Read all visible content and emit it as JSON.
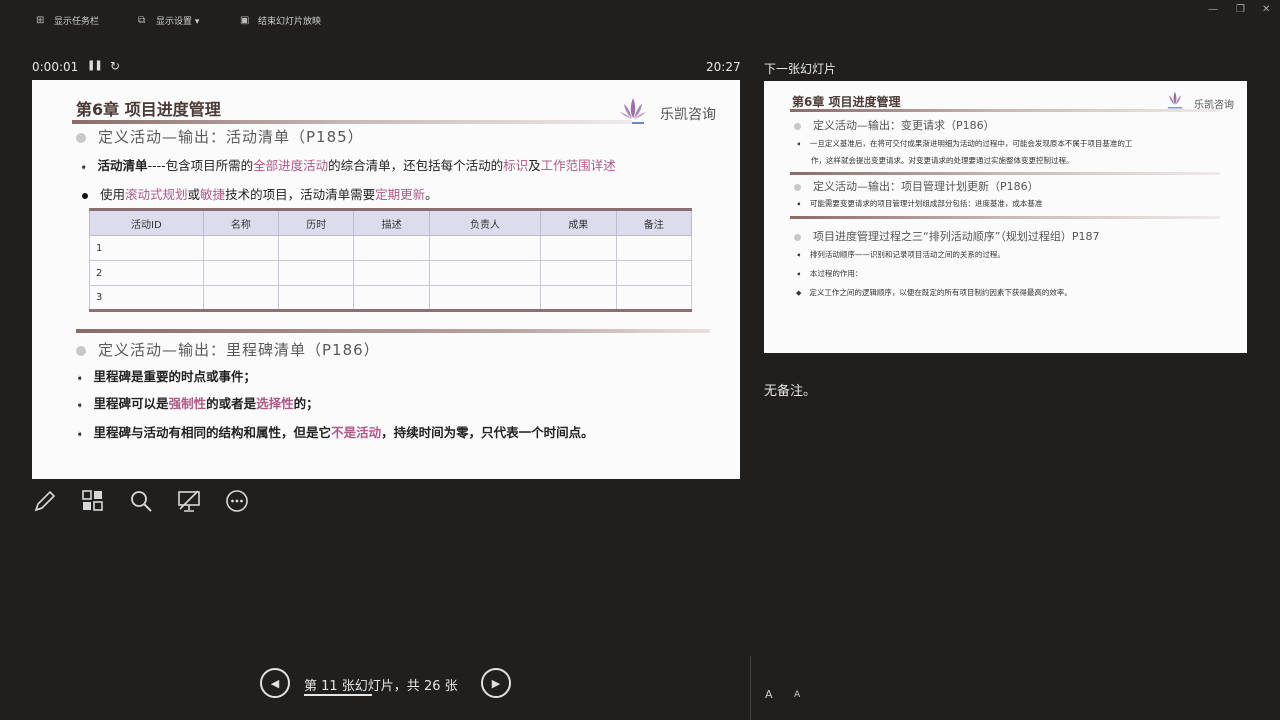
{
  "toolbar": {
    "show_taskbar": "显示任务栏",
    "display_settings": "显示设置 ▾",
    "end_slideshow": "结束幻灯片放映"
  },
  "presenter": {
    "elapsed": "0:00:01",
    "clock": "20:27",
    "next_label": "下一张幻灯片",
    "notes": "无备注。",
    "slide_counter": "第 11 张幻灯片，共 26 张",
    "font_increase": "A",
    "font_decrease": "A"
  },
  "slide": {
    "title": "第6章 项目进度管理",
    "logo_text": "乐凯咨询",
    "section1": "定义活动—输出：活动清单（P185）",
    "b1_bold": "活动清单",
    "b1_a": "----包含项目所需的",
    "b1_hl1": "全部进度活动",
    "b1_b": "的综合清单，还包括每个活动的",
    "b1_hl2": "标识",
    "b1_c": "及",
    "b1_hl3": "工作范围详述",
    "b2_a": "使用",
    "b2_hl1": "滚动式规划",
    "b2_b": "或",
    "b2_hl2": "敏捷",
    "b2_c": "技术的项目，活动清单需要",
    "b2_hl3": "定期更新",
    "b2_d": "。",
    "table": {
      "headers": [
        "活动ID",
        "名称",
        "历时",
        "描述",
        "负责人",
        "成果",
        "备注"
      ],
      "rows": [
        "1",
        "2",
        "3"
      ]
    },
    "section2": "定义活动—输出：里程碑清单（P186）",
    "m1": "里程碑是重要的时点或事件；",
    "m2_a": "里程碑可以是",
    "m2_hl1": "强制性",
    "m2_b": "的或者是",
    "m2_hl2": "选择性",
    "m2_c": "的；",
    "m3_a": "里程碑与活动有相同的结构和属性，但是它",
    "m3_hl": "不是活动",
    "m3_b": "，持续时间为零，只代表一个时间点。"
  },
  "next_slide": {
    "title": "第6章 项目进度管理",
    "logo_text": "乐凯咨询",
    "s1": "定义活动—输出：变更请求（P186）",
    "s1_b1": "一旦定义基准后，在将可交付成果渐进明细为活动的过程中，可能会发现原本不属于项目基准的工",
    "s1_b2": "作，这样就会提出变更请求。对变更请求的处理要通过实施整体变更控制过程。",
    "s2": "定义活动—输出：项目管理计划更新（P186）",
    "s2_b1": "可能需要变更请求的项目管理计划组成部分包括：进度基准，成本基准",
    "s3": "项目进度管理过程之三“排列活动顺序”（规划过程组）P187",
    "s3_b1": "排列活动顺序——识别和记录项目活动之间的关系的过程。",
    "s3_b2": "本过程的作用：",
    "s3_b3": "定义工作之间的逻辑顺序，以便在既定的所有项目制约因素下获得最高的效率。"
  }
}
